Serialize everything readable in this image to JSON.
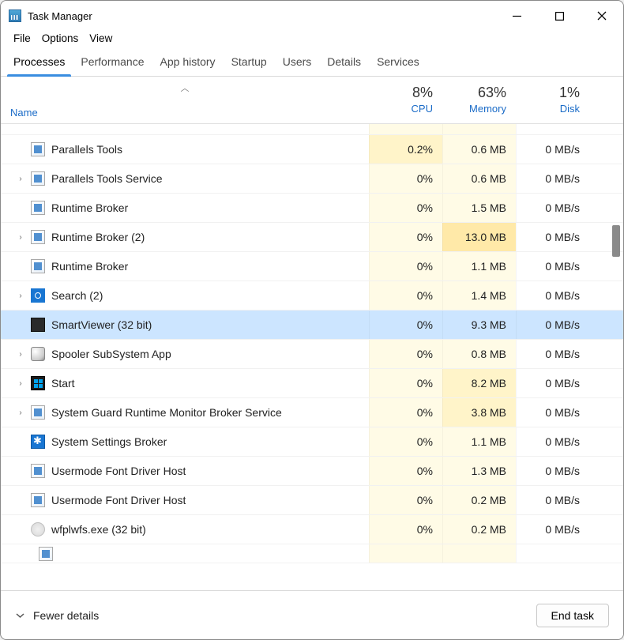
{
  "window": {
    "title": "Task Manager"
  },
  "menu": {
    "file": "File",
    "options": "Options",
    "view": "View"
  },
  "tabs": {
    "processes": "Processes",
    "performance": "Performance",
    "apphistory": "App history",
    "startup": "Startup",
    "users": "Users",
    "details": "Details",
    "services": "Services"
  },
  "columns": {
    "name": "Name",
    "cpu": {
      "pct": "8%",
      "label": "CPU"
    },
    "memory": {
      "pct": "63%",
      "label": "Memory"
    },
    "disk": {
      "pct": "1%",
      "label": "Disk"
    }
  },
  "processes": [
    {
      "name": "Parallels Tools",
      "cpu": "0.2%",
      "mem": "0.6 MB",
      "disk": "0 MB/s",
      "expand": false,
      "icon": "app-blue",
      "cpu_heat": 1,
      "mem_heat": 0,
      "selected": false
    },
    {
      "name": "Parallels Tools Service",
      "cpu": "0%",
      "mem": "0.6 MB",
      "disk": "0 MB/s",
      "expand": true,
      "icon": "app-blue",
      "cpu_heat": 0,
      "mem_heat": 0,
      "selected": false
    },
    {
      "name": "Runtime Broker",
      "cpu": "0%",
      "mem": "1.5 MB",
      "disk": "0 MB/s",
      "expand": false,
      "icon": "app-blue",
      "cpu_heat": 0,
      "mem_heat": 0,
      "selected": false
    },
    {
      "name": "Runtime Broker (2)",
      "cpu": "0%",
      "mem": "13.0 MB",
      "disk": "0 MB/s",
      "expand": true,
      "icon": "app-blue",
      "cpu_heat": 0,
      "mem_heat": 2,
      "selected": false
    },
    {
      "name": "Runtime Broker",
      "cpu": "0%",
      "mem": "1.1 MB",
      "disk": "0 MB/s",
      "expand": false,
      "icon": "app-blue",
      "cpu_heat": 0,
      "mem_heat": 0,
      "selected": false
    },
    {
      "name": "Search (2)",
      "cpu": "0%",
      "mem": "1.4 MB",
      "disk": "0 MB/s",
      "expand": true,
      "icon": "search",
      "cpu_heat": 0,
      "mem_heat": 0,
      "selected": false
    },
    {
      "name": "SmartViewer (32 bit)",
      "cpu": "0%",
      "mem": "9.3 MB",
      "disk": "0 MB/s",
      "expand": false,
      "icon": "smartviewer",
      "cpu_heat": 0,
      "mem_heat": 0,
      "selected": true
    },
    {
      "name": "Spooler SubSystem App",
      "cpu": "0%",
      "mem": "0.8 MB",
      "disk": "0 MB/s",
      "expand": true,
      "icon": "spooler",
      "cpu_heat": 0,
      "mem_heat": 0,
      "selected": false
    },
    {
      "name": "Start",
      "cpu": "0%",
      "mem": "8.2 MB",
      "disk": "0 MB/s",
      "expand": true,
      "icon": "start",
      "cpu_heat": 0,
      "mem_heat": 1,
      "selected": false
    },
    {
      "name": "System Guard Runtime Monitor Broker Service",
      "cpu": "0%",
      "mem": "3.8 MB",
      "disk": "0 MB/s",
      "expand": true,
      "icon": "app-blue",
      "cpu_heat": 0,
      "mem_heat": 1,
      "selected": false
    },
    {
      "name": "System Settings Broker",
      "cpu": "0%",
      "mem": "1.1 MB",
      "disk": "0 MB/s",
      "expand": false,
      "icon": "gear",
      "cpu_heat": 0,
      "mem_heat": 0,
      "selected": false
    },
    {
      "name": "Usermode Font Driver Host",
      "cpu": "0%",
      "mem": "1.3 MB",
      "disk": "0 MB/s",
      "expand": false,
      "icon": "app-blue",
      "cpu_heat": 0,
      "mem_heat": 0,
      "selected": false
    },
    {
      "name": "Usermode Font Driver Host",
      "cpu": "0%",
      "mem": "0.2 MB",
      "disk": "0 MB/s",
      "expand": false,
      "icon": "app-blue",
      "cpu_heat": 0,
      "mem_heat": 0,
      "selected": false
    },
    {
      "name": "wfplwfs.exe (32 bit)",
      "cpu": "0%",
      "mem": "0.2 MB",
      "disk": "0 MB/s",
      "expand": false,
      "icon": "wfp",
      "cpu_heat": 0,
      "mem_heat": 0,
      "selected": false
    }
  ],
  "footer": {
    "fewer": "Fewer details",
    "endtask": "End task"
  }
}
